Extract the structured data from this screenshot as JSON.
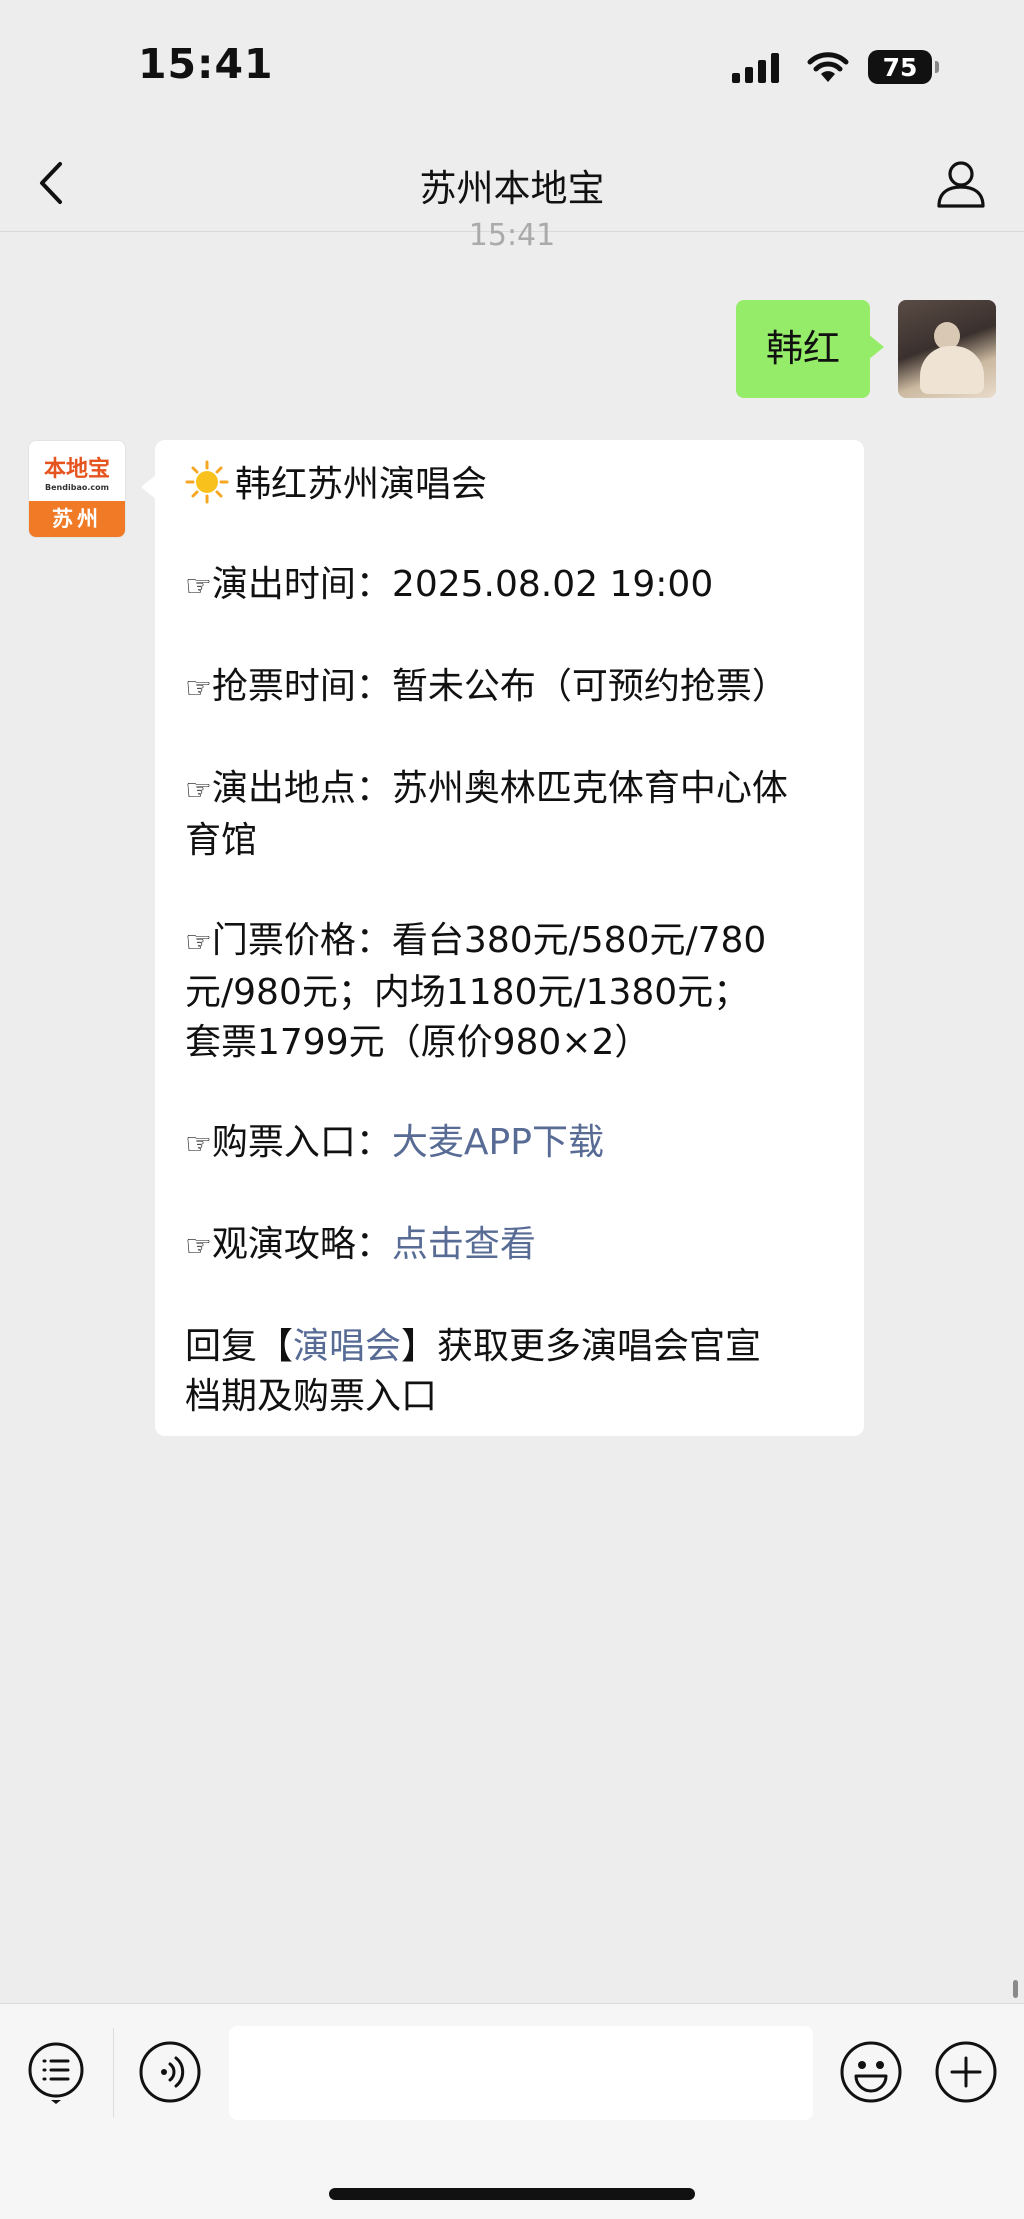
{
  "status_bar": {
    "time": "15:41",
    "battery": "75"
  },
  "nav": {
    "title": "苏州本地宝",
    "back_icon": "chevron-left-icon",
    "profile_icon": "user-icon"
  },
  "timestamp": "15:41",
  "outgoing_message": {
    "text": "韩红",
    "bubble_color": "#95ec69"
  },
  "sender": {
    "logo_brand": "本地宝",
    "logo_url": "Bendibao.com",
    "logo_city": "苏州",
    "logo_color": "#f07a25"
  },
  "incoming_message": {
    "title": "韩红苏州演唱会",
    "hand_glyph": "☞",
    "show_time_label": "演出时间：",
    "show_time_value": "2025.08.02 19:00",
    "ticket_time_label": "抢票时间：",
    "ticket_time_value": "暂未公布（可预约抢票）",
    "venue_label": "演出地点：",
    "venue_value_line1": "苏州奥林匹克体育中心体",
    "venue_value_line2": "育馆",
    "price_label": "门票价格：",
    "price_line1": "看台380元/580元/780",
    "price_line2": "元/980元；内场1180元/1380元；",
    "price_line3": "套票1799元（原价980×2）",
    "buy_label": "购票入口：",
    "buy_link": "大麦APP下载",
    "guide_label": "观演攻略：",
    "guide_link": "点击查看",
    "reply_prefix": "回复【",
    "reply_keyword": "演唱会",
    "reply_suffix": "】获取更多演唱会官宣",
    "reply_line2": "档期及购票入口",
    "link_color": "#576b95"
  },
  "input_bar": {
    "menu_icon": "menu-list-icon",
    "voice_icon": "voice-icon",
    "emoji_icon": "emoji-icon",
    "plus_icon": "plus-icon"
  }
}
